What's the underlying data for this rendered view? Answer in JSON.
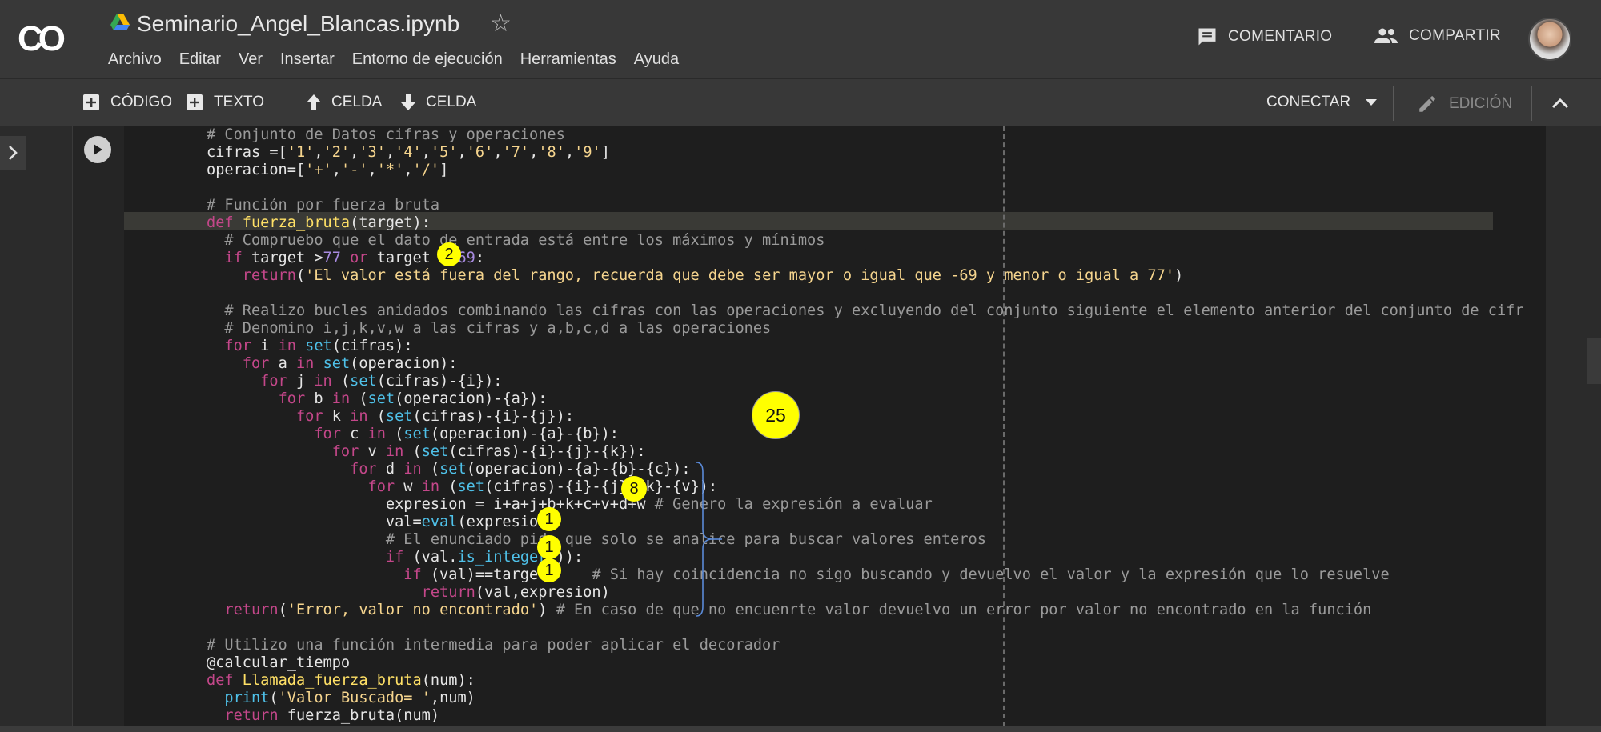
{
  "app": {
    "logo_text": "CO",
    "doc_title": "Seminario_Angel_Blancas.ipynb",
    "menu": [
      "Archivo",
      "Editar",
      "Ver",
      "Insertar",
      "Entorno de ejecución",
      "Herramientas",
      "Ayuda"
    ],
    "comment_label": "COMENTARIO",
    "share_label": "COMPARTIR"
  },
  "toolbar": {
    "code_label": "CÓDIGO",
    "text_label": "TEXTO",
    "cell_up_label": "CELDA",
    "cell_down_label": "CELDA",
    "connect_label": "CONECTAR",
    "edit_label": "EDICIÓN"
  },
  "code": {
    "lines": [
      "# Conjunto de Datos cifras y operaciones",
      "cifras =['1','2','3','4','5','6','7','8','9']",
      "operacion=['+','-','*','/']",
      "",
      "# Función por fuerza bruta",
      "def fuerza_bruta(target):",
      "  # Compruebo que el dato de entrada está entre los máximos y mínimos",
      "  if target >77 or target <-69:",
      "    return('El valor está fuera del rango, recuerda que debe ser mayor o igual que -69 y menor o igual a 77')",
      "",
      "  # Realizo bucles anidados combinando las cifras con las operaciones y excluyendo del conjunto siguiente el elemento anterior del conjunto de cifr",
      "  # Denomino i,j,k,v,w a las cifras y a,b,c,d a las operaciones",
      "  for i in set(cifras):",
      "    for a in set(operacion):",
      "      for j in (set(cifras)-{i}):",
      "        for b in (set(operacion)-{a}):",
      "          for k in (set(cifras)-{i}-{j}):",
      "            for c in (set(operacion)-{a}-{b}):",
      "              for v in (set(cifras)-{i}-{j}-{k}):",
      "                for d in (set(operacion)-{a}-{b}-{c}):",
      "                  for w in (set(cifras)-{i}-{j}-{k}-{v}):",
      "                    expresion = i+a+j+b+k+c+v+d+w # Genero la expresión a evaluar",
      "                    val=eval(expresion)",
      "                    # El enunciado pide que solo se analice para buscar valores enteros",
      "                    if (val.is_integer()):",
      "                      if (val)==target:    # Si hay coincidencia no sigo buscando y devuelvo el valor y la expresión que lo resuelve",
      "                        return(val,expresion)",
      "  return('Error, valor no encontrado') # En caso de que no encuenrte valor devuelvo un error por valor no encontrado en la función",
      "",
      "# Utilizo una función intermedia para poder aplicar el decorador",
      "@calcular_tiempo",
      "def Llamada_fuerza_bruta(num):",
      "  print('Valor Buscado= ',num)",
      "  return fuerza_bruta(num)"
    ]
  },
  "annotations": [
    "2",
    "25",
    "8",
    "1",
    "1",
    "1"
  ],
  "colors": {
    "annotation_fill": "#ffff00",
    "keyword": "#c4478a",
    "builtin": "#4fc1e9",
    "string": "#f6d58e",
    "comment": "#9a9a9a",
    "number": "#a88be0"
  }
}
